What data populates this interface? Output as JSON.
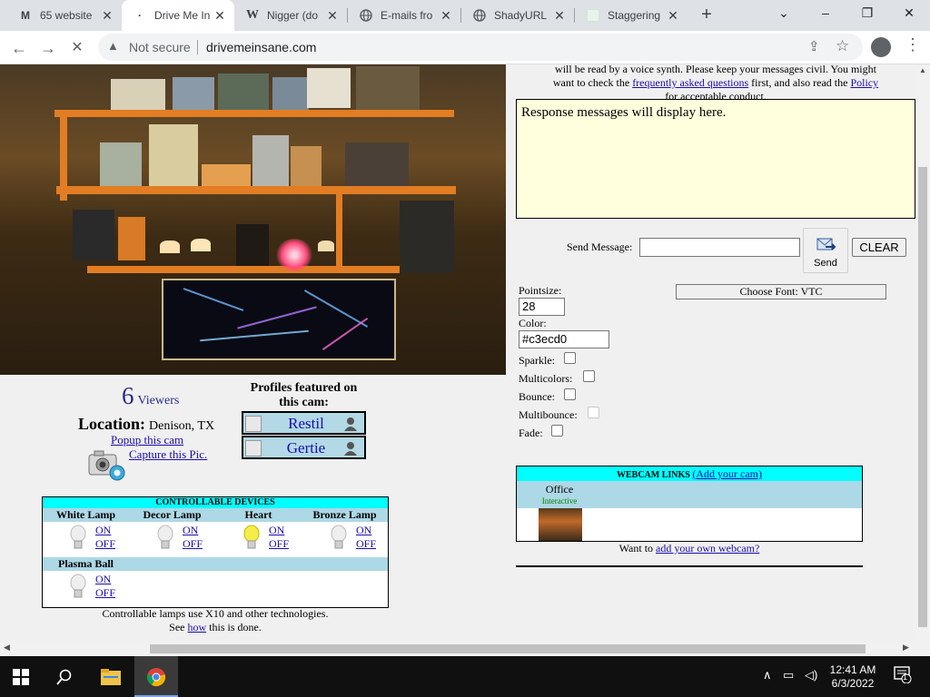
{
  "browser": {
    "tabs": [
      {
        "favicon": "M",
        "title": "65 website"
      },
      {
        "favicon": "·",
        "title": "Drive Me In"
      },
      {
        "favicon": "W",
        "title": "Nigger (do"
      },
      {
        "favicon": "globe-icon",
        "title": "E-mails fro"
      },
      {
        "favicon": "globe-icon",
        "title": "ShadyURL"
      },
      {
        "favicon": "page-icon",
        "title": "Staggering"
      }
    ],
    "new_tab": "+",
    "controls": {
      "minimize": "–",
      "restore": "❐",
      "close": "✕",
      "tabsearch": "⌄"
    },
    "nav": {
      "back": "←",
      "forward": "→",
      "stop": "✕"
    },
    "security_label": "Not secure",
    "url": "drivemeinsane.com"
  },
  "page": {
    "viewers": {
      "count": "6",
      "label": "Viewers"
    },
    "location": {
      "label": "Location:",
      "value": "Denison, TX"
    },
    "popup_link": "Popup this cam",
    "capture_link": "Capture this Pic.",
    "profiles": {
      "heading": "Profiles featured on this cam:",
      "items": [
        "Restil",
        "Gertie"
      ]
    },
    "devices": {
      "heading": "CONTROLLABLE DEVICES",
      "on_label": "ON",
      "off_label": "OFF",
      "items": [
        {
          "name": "White Lamp",
          "lit": false
        },
        {
          "name": "Decor Lamp",
          "lit": false
        },
        {
          "name": "Heart",
          "lit": true
        },
        {
          "name": "Bronze Lamp",
          "lit": false
        },
        {
          "name": "Plasma Ball",
          "lit": false
        }
      ],
      "note_line1": "Controllable lamps use X10 and other technologies.",
      "note_pre": "See",
      "note_link": "how",
      "note_post": "this is done."
    },
    "chat": {
      "top_line1": "will be read by a voice synth. Please keep your messages civil. You might",
      "top_line2_pre": "want to check the",
      "faq_link": "frequently asked questions",
      "top_line2_mid": "first, and also read the",
      "policy_link": "Policy",
      "top_line3": "for acceptable conduct.",
      "response_placeholder": "Response messages will display here.",
      "send_label": "Send Message:",
      "send_button": "Send",
      "clear_button": "CLEAR",
      "pointsize_label": "Pointsize:",
      "pointsize_value": "28",
      "color_label": "Color:",
      "color_value": "#c3ecd0",
      "font_button": "Choose Font: VTC",
      "options": [
        {
          "label": "Sparkle:",
          "disabled": false
        },
        {
          "label": "Multicolors:",
          "disabled": false
        },
        {
          "label": "Bounce:",
          "disabled": false
        },
        {
          "label": "Multibounce:",
          "disabled": true
        },
        {
          "label": "Fade:",
          "disabled": false
        }
      ]
    },
    "webcam_links": {
      "heading": "WEBCAM LINKS",
      "add_link": "(Add your cam)",
      "cam_name": "Office",
      "cam_type": "Interactive",
      "note_pre": "Want to",
      "note_link": "add your own webcam?"
    }
  },
  "taskbar": {
    "time": "12:41 AM",
    "date": "6/3/2022",
    "notification_count": "1"
  },
  "colors": {
    "cyan_header": "#00ffff",
    "light_blue": "#add8e6",
    "response_bg": "#ffffdd",
    "link": "#1a0dab",
    "viewer_text": "#29298a"
  }
}
